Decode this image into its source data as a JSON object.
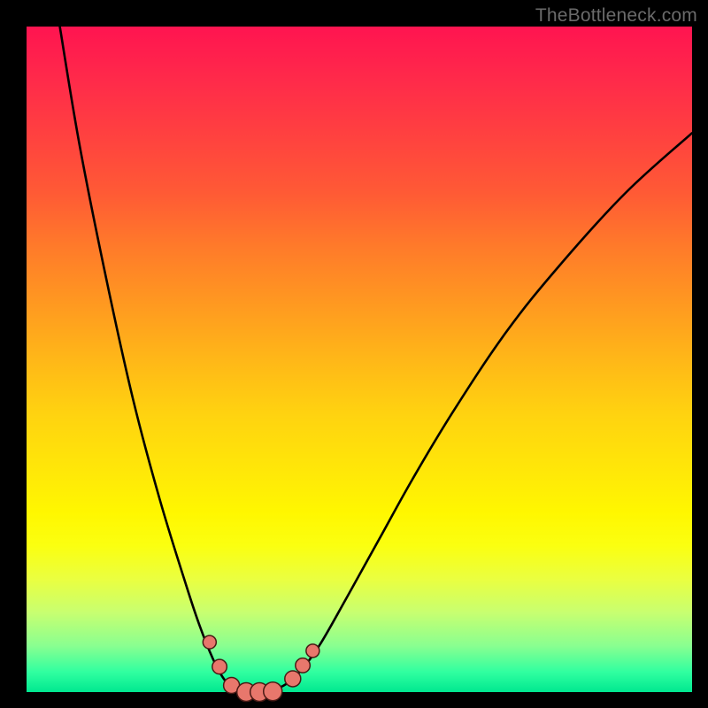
{
  "watermark": "TheBottleneck.com",
  "chart_data": {
    "type": "line",
    "title": "",
    "xlabel": "",
    "ylabel": "",
    "xlim": [
      0,
      100
    ],
    "ylim": [
      0,
      100
    ],
    "grid": false,
    "series": [
      {
        "name": "curve",
        "x": [
          5,
          8,
          12,
          16,
          20,
          24,
          26,
          28,
          29.5,
          31,
          33,
          35,
          37,
          39,
          41,
          44,
          48,
          53,
          58,
          64,
          72,
          80,
          90,
          100
        ],
        "y": [
          100,
          82,
          62,
          44,
          29,
          16,
          10,
          5,
          2.2,
          0.6,
          0,
          0,
          0.3,
          1.2,
          3,
          7,
          14,
          23,
          32,
          42,
          54,
          64,
          75,
          84
        ]
      }
    ],
    "markers": [
      {
        "x": 27.5,
        "y": 7.5,
        "r": 1.0
      },
      {
        "x": 29.0,
        "y": 3.8,
        "r": 1.1
      },
      {
        "x": 30.8,
        "y": 1.0,
        "r": 1.2
      },
      {
        "x": 33.0,
        "y": 0.0,
        "r": 1.4
      },
      {
        "x": 35.0,
        "y": 0.0,
        "r": 1.4
      },
      {
        "x": 37.0,
        "y": 0.1,
        "r": 1.4
      },
      {
        "x": 40.0,
        "y": 2.0,
        "r": 1.2
      },
      {
        "x": 41.5,
        "y": 4.0,
        "r": 1.1
      },
      {
        "x": 43.0,
        "y": 6.2,
        "r": 1.0
      }
    ],
    "gradient_stops": [
      {
        "pct": 0,
        "color": "#ff1450"
      },
      {
        "pct": 50,
        "color": "#ffb718"
      },
      {
        "pct": 78,
        "color": "#fbff10"
      },
      {
        "pct": 100,
        "color": "#00e890"
      }
    ]
  }
}
